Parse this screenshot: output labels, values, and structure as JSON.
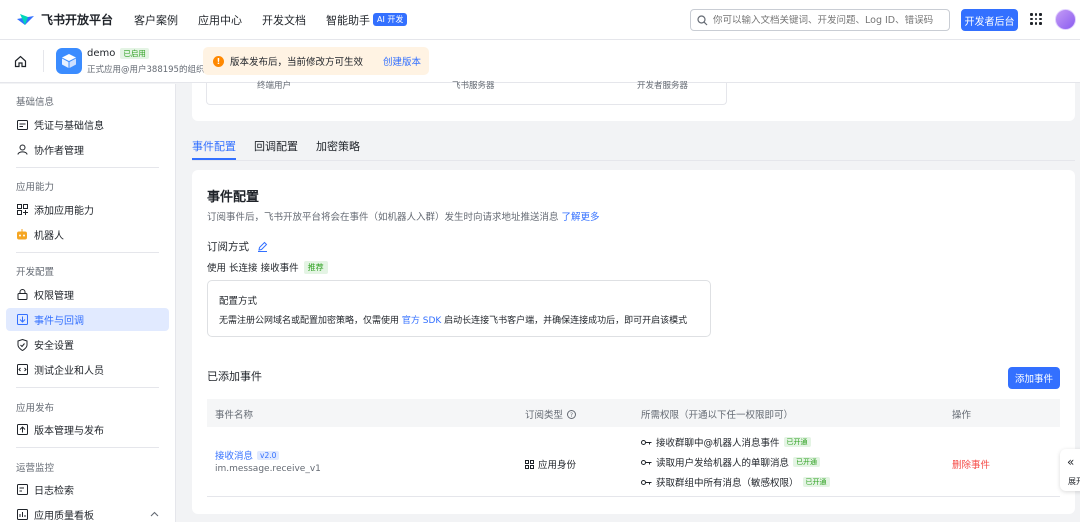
{
  "topnav": {
    "logo_text": "飞书开放平台",
    "items": [
      "客户案例",
      "应用中心",
      "开发文档",
      "智能助手"
    ],
    "ai_badge": "AI 开发",
    "search_placeholder": "你可以输入文档关键词、开发问题、Log ID、错误码",
    "dev_console": "开发者后台"
  },
  "app": {
    "name": "demo",
    "status": "已启用",
    "subtitle": "正式应用@用户388195的组织",
    "notice": "版本发布后，当前修改方可生效",
    "notice_action": "创建版本"
  },
  "sidebar": {
    "sections": [
      {
        "title": "基础信息",
        "items": [
          {
            "label": "凭证与基础信息",
            "icon": "credential-icon"
          },
          {
            "label": "协作者管理",
            "icon": "user-icon"
          }
        ]
      },
      {
        "title": "应用能力",
        "items": [
          {
            "label": "添加应用能力",
            "icon": "add-capability-icon"
          },
          {
            "label": "机器人",
            "icon": "robot-icon"
          }
        ]
      },
      {
        "title": "开发配置",
        "items": [
          {
            "label": "权限管理",
            "icon": "lock-icon"
          },
          {
            "label": "事件与回调",
            "icon": "event-icon"
          },
          {
            "label": "安全设置",
            "icon": "shield-icon"
          },
          {
            "label": "测试企业和人员",
            "icon": "test-icon"
          }
        ]
      },
      {
        "title": "应用发布",
        "items": [
          {
            "label": "版本管理与发布",
            "icon": "upload-icon"
          }
        ]
      },
      {
        "title": "运营监控",
        "items": [
          {
            "label": "日志检索",
            "icon": "log-icon"
          },
          {
            "label": "应用质量看板",
            "icon": "dashboard-icon"
          }
        ]
      }
    ],
    "active": "事件与回调"
  },
  "flow": {
    "labels": [
      "终端用户",
      "飞书服务器",
      "开发者服务器"
    ]
  },
  "tabs": [
    "事件配置",
    "回调配置",
    "加密策略"
  ],
  "event_config": {
    "title": "事件配置",
    "description": "订阅事件后，飞书开放平台将会在事件（如机器人入群）发生时向请求地址推送消息",
    "learn_more": "了解更多",
    "subscribe_title": "订阅方式",
    "usage_prefix": "使用",
    "usage_mode": "长连接",
    "usage_suffix": "接收事件",
    "recommend": "推荐",
    "config_title": "配置方式",
    "config_text_1": "无需注册公网域名或配置加密策略，仅需使用",
    "config_link": "官方 SDK",
    "config_text_2": "启动长连接飞书客户端，并确保连接成功后，即可开启该模式",
    "added_title": "已添加事件",
    "add_button": "添加事件"
  },
  "table": {
    "headers": {
      "name": "事件名称",
      "type": "订阅类型",
      "perms": "所需权限（开通以下任一权限即可）",
      "ops": "操作"
    },
    "rows": [
      {
        "name": "接收消息",
        "version": "v2.0",
        "code": "im.message.receive_v1",
        "type": "应用身份",
        "perms": [
          {
            "label": "接收群聊中@机器人消息事件",
            "status": "已开通"
          },
          {
            "label": "读取用户发给机器人的单聊消息",
            "status": "已开通"
          },
          {
            "label": "获取群组中所有消息（敏感权限）",
            "status": "已开通"
          }
        ],
        "action": "删除事件"
      }
    ]
  },
  "expand_label": "展开",
  "colors": {
    "primary": "#3370ff",
    "danger": "#f54a45",
    "success": "#2ea121",
    "warning": "#ff8800"
  }
}
